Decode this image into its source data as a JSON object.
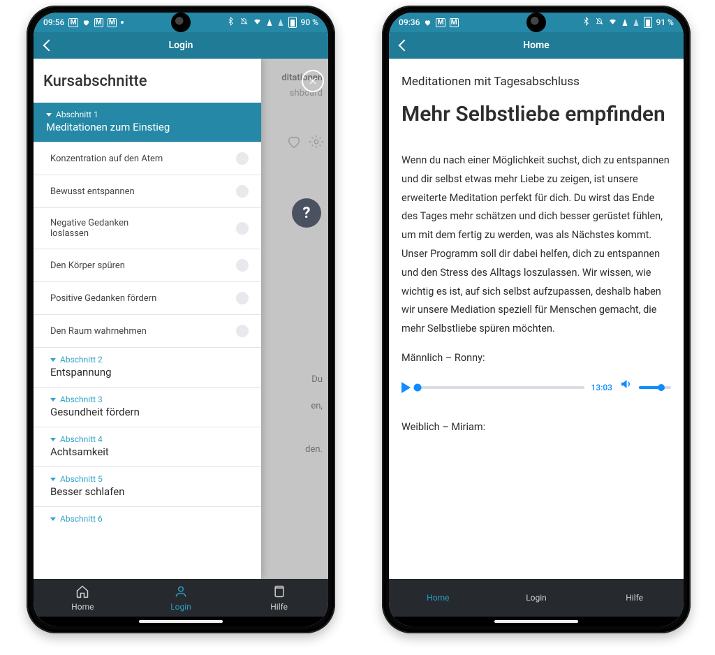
{
  "left": {
    "status": {
      "time": "09:56",
      "icons_left": [
        "M",
        "heart",
        "M",
        "M",
        "dot"
      ],
      "battery": "90 %"
    },
    "appbar": {
      "title": "Login"
    },
    "background": {
      "top1": "ditationen",
      "top2": "shboard",
      "lines": [
        "Du",
        "en,",
        "den."
      ],
      "close_icon": "close",
      "heart": "heart-icon",
      "gear": "gear-icon",
      "help": "?"
    },
    "drawer": {
      "heading": "Kursabschnitte",
      "active": {
        "kicker": "Abschnitt 1",
        "title": "Meditationen zum Einstieg"
      },
      "lessons": [
        "Konzentration auf den Atem",
        "Bewusst entspannen",
        "Negative Gedanken loslassen",
        "Den Körper spüren",
        "Positive Gedanken fördern",
        "Den Raum wahrnehmen"
      ],
      "sections": [
        {
          "kicker": "Abschnitt 2",
          "title": "Entspannung"
        },
        {
          "kicker": "Abschnitt 3",
          "title": "Gesundheit fördern"
        },
        {
          "kicker": "Abschnitt 4",
          "title": "Achtsamkeit"
        },
        {
          "kicker": "Abschnitt 5",
          "title": "Besser schlafen"
        },
        {
          "kicker": "Abschnitt 6",
          "title": ""
        }
      ]
    },
    "bottom": {
      "home": "Home",
      "login": "Login",
      "hilfe": "Hilfe",
      "active": "login"
    }
  },
  "right": {
    "status": {
      "time": "09:36",
      "icons_left": [
        "heart",
        "M",
        "M"
      ],
      "battery": "91 %"
    },
    "appbar": {
      "title": "Home"
    },
    "article": {
      "eyebrow": "Meditationen mit Tagesabschluss",
      "title": "Mehr Selbstliebe empfinden",
      "body": "Wenn du nach einer Möglichkeit suchst, dich zu entspannen und dir selbst etwas mehr Liebe zu zeigen, ist unsere erweiterte Meditation perfekt für dich. Du wirst das Ende des Tages mehr schätzen und dich besser gerüstet fühlen, um mit dem fertig zu werden, was als Nächstes kommt. Unser Programm soll dir dabei helfen, dich zu entspannen und den Stress des Alltags loszulassen. Wir wissen, wie wichtig es ist, auf sich selbst aufzupassen, deshalb haben wir unsere Mediation speziell für Menschen gemacht, die mehr Selbstliebe spüren möchten.",
      "voice1": "Männlich – Ronny:",
      "duration": "13:03",
      "voice2": "Weiblich – Miriam:"
    },
    "bottom": {
      "home": "Home",
      "login": "Login",
      "hilfe": "Hilfe",
      "active": "home"
    }
  }
}
